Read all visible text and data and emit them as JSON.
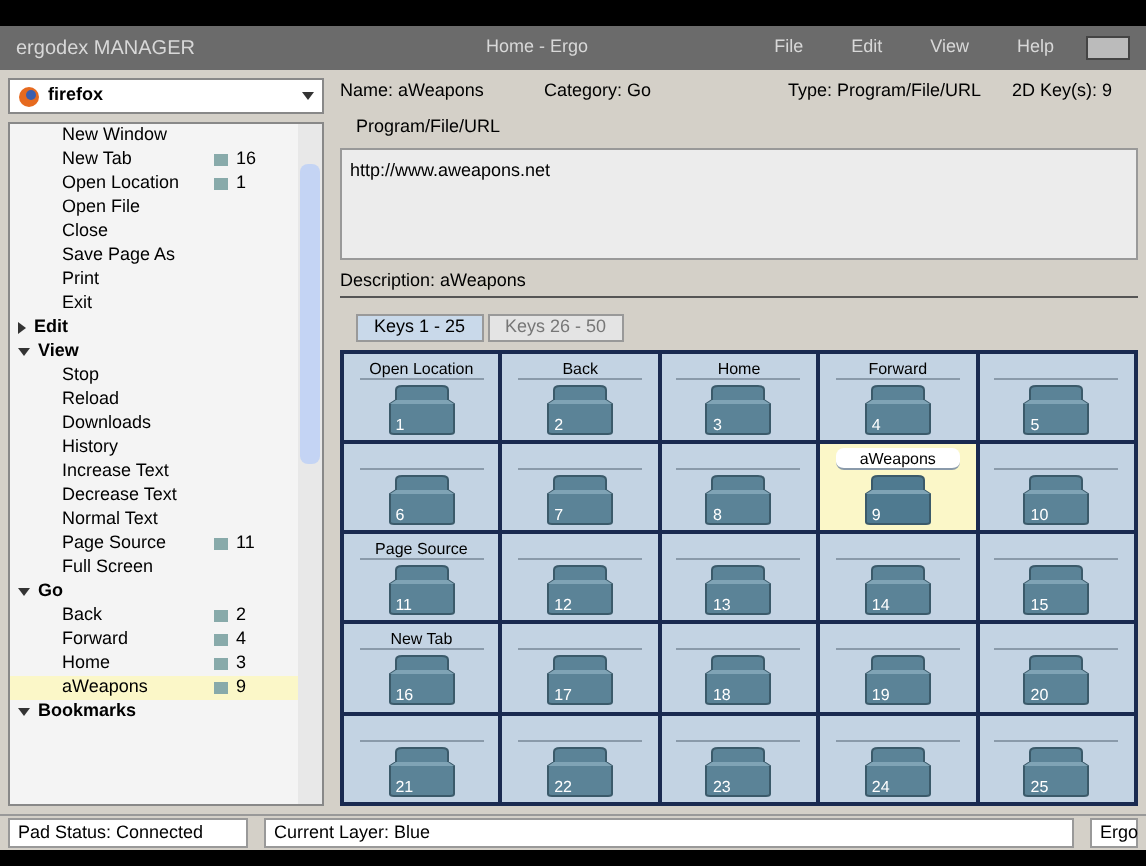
{
  "window": {
    "title": "ergodex MANAGER",
    "document": "Home - Ergo",
    "menu": [
      "File",
      "Edit",
      "View",
      "Help"
    ]
  },
  "app_selector": {
    "value": "firefox"
  },
  "tree": [
    {
      "children": [
        {
          "label": "New Window",
          "selected": false
        },
        {
          "label": "New Tab",
          "key": "16",
          "selected": false
        },
        {
          "label": "Open Location",
          "key": "1",
          "selected": false
        },
        {
          "label": "Open File",
          "selected": false
        },
        {
          "label": "Close",
          "selected": false
        },
        {
          "label": "Save Page As",
          "selected": false
        },
        {
          "label": "Print",
          "selected": false
        },
        {
          "label": "Exit",
          "selected": false
        }
      ]
    },
    {
      "label": "Edit",
      "expanded": false
    },
    {
      "label": "View",
      "expanded": true,
      "children": [
        {
          "label": "Stop",
          "selected": false
        },
        {
          "label": "Reload",
          "selected": false
        },
        {
          "label": "Downloads",
          "selected": false
        },
        {
          "label": "History",
          "selected": false
        },
        {
          "label": "Increase Text",
          "selected": false
        },
        {
          "label": "Decrease Text",
          "selected": false
        },
        {
          "label": "Normal Text",
          "selected": false
        },
        {
          "label": "Page Source",
          "key": "11",
          "selected": false
        },
        {
          "label": "Full Screen",
          "selected": false
        }
      ]
    },
    {
      "label": "Go",
      "expanded": true,
      "children": [
        {
          "label": "Back",
          "key": "2",
          "selected": false
        },
        {
          "label": "Forward",
          "key": "4",
          "selected": false
        },
        {
          "label": "Home",
          "key": "3",
          "selected": false
        },
        {
          "label": "aWeapons",
          "key": "9",
          "selected": true
        }
      ]
    },
    {
      "label": "Bookmarks",
      "expanded": true
    }
  ],
  "details": {
    "name": "Name: aWeapons",
    "category": "Category: Go",
    "type": "Type: Program/File/URL",
    "keys": "2D Key(s): 9",
    "url_label": "Program/File/URL",
    "url": "http://www.aweapons.net",
    "description": "Description: aWeapons"
  },
  "tabs": [
    {
      "label": "Keys 1 - 25",
      "selected": true
    },
    {
      "label": "Keys 26 - 50",
      "selected": false
    }
  ],
  "keys": [
    {
      "label": "Open Location",
      "number": "1",
      "selected": false
    },
    {
      "label": "Back",
      "number": "2",
      "selected": false
    },
    {
      "label": "Home",
      "number": "3",
      "selected": false
    },
    {
      "label": "Forward",
      "number": "4",
      "selected": false
    },
    {
      "number": "5",
      "selected": false
    },
    {
      "number": "6",
      "selected": false
    },
    {
      "number": "7",
      "selected": false
    },
    {
      "number": "8",
      "selected": false
    },
    {
      "label": "aWeapons",
      "number": "9",
      "selected": true
    },
    {
      "number": "10",
      "selected": false
    },
    {
      "label": "Page Source",
      "number": "11",
      "selected": false
    },
    {
      "number": "12",
      "selected": false
    },
    {
      "number": "13",
      "selected": false
    },
    {
      "number": "14",
      "selected": false
    },
    {
      "number": "15",
      "selected": false
    },
    {
      "label": "New Tab",
      "number": "16",
      "selected": false
    },
    {
      "number": "17",
      "selected": false
    },
    {
      "number": "18",
      "selected": false
    },
    {
      "number": "19",
      "selected": false
    },
    {
      "number": "20",
      "selected": false
    },
    {
      "number": "21",
      "selected": false
    },
    {
      "number": "22",
      "selected": false
    },
    {
      "number": "23",
      "selected": false
    },
    {
      "number": "24",
      "selected": false
    },
    {
      "number": "25",
      "selected": false
    }
  ],
  "status_bar": {
    "pad": "Pad Status: Connected",
    "layer": "Current Layer: Blue",
    "right": "Ergo"
  }
}
